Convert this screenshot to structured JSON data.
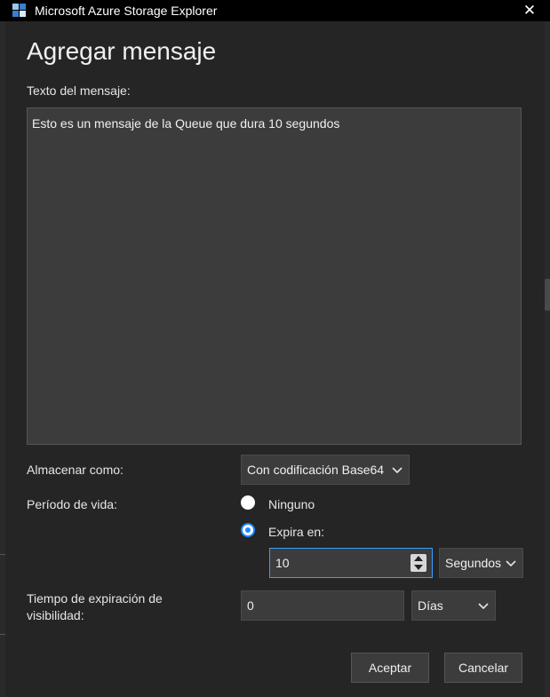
{
  "window": {
    "title": "Microsoft Azure Storage Explorer",
    "close_glyph": "✕"
  },
  "dialog": {
    "heading": "Agregar mensaje",
    "message_label": "Texto del mensaje:",
    "message_value": "Esto es un mensaje de la Queue que dura 10 segundos",
    "store_as_label": "Almacenar como:",
    "store_as_value": "Con codificación Base64",
    "ttl_label": "Período de vida:",
    "ttl_options": [
      {
        "label": "Ninguno",
        "selected": false
      },
      {
        "label": "Expira en:",
        "selected": true
      }
    ],
    "ttl_value": "10",
    "ttl_unit": "Segundos",
    "visibility_label_line1": "Tiempo de expiración de",
    "visibility_label_line2": "visibilidad:",
    "visibility_value": "0",
    "visibility_unit": "Días",
    "ok_label": "Aceptar",
    "cancel_label": "Cancelar"
  },
  "colors": {
    "accent": "#1a8cff",
    "dialog_bg": "#252526",
    "field_bg": "#3c3c3c"
  },
  "icons": [
    "azure-storage-explorer-icon",
    "close-icon",
    "chevron-down-icon",
    "spinner-icon"
  ]
}
